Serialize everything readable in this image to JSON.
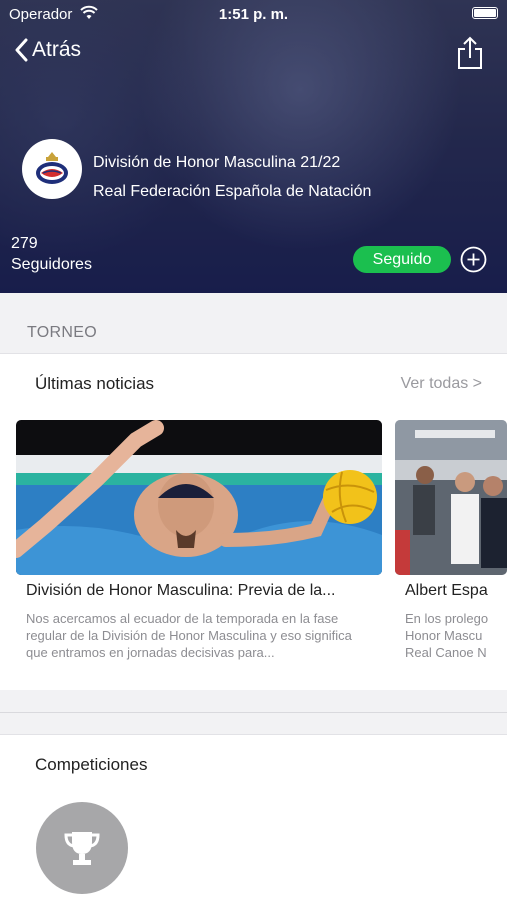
{
  "status_bar": {
    "carrier": "Operador",
    "time": "1:51 p. m."
  },
  "nav": {
    "back_label": "Atrás"
  },
  "header": {
    "league_name": "División de Honor Masculina 21/22",
    "organization": "Real Federación Española de Natación",
    "followers_count": "279",
    "followers_label": "Seguidores",
    "follow_button": "Seguido"
  },
  "section": {
    "label": "TORNEO"
  },
  "news": {
    "title": "Últimas noticias",
    "see_all": "Ver todas >",
    "articles": [
      {
        "title": "División de Honor Masculina: Previa de la...",
        "description": "Nos acercamos al ecuador de la temporada en la fase regular de la División de Honor Masculina y eso significa que entramos en jornadas decisivas para..."
      },
      {
        "title": "Albert Espa",
        "description": "En los prolego Honor Mascu Real Canoe N"
      }
    ]
  },
  "competitions": {
    "title": "Competiciones"
  },
  "colors": {
    "accent_green": "#1bbf4f",
    "header_navy": "#1b2150"
  }
}
